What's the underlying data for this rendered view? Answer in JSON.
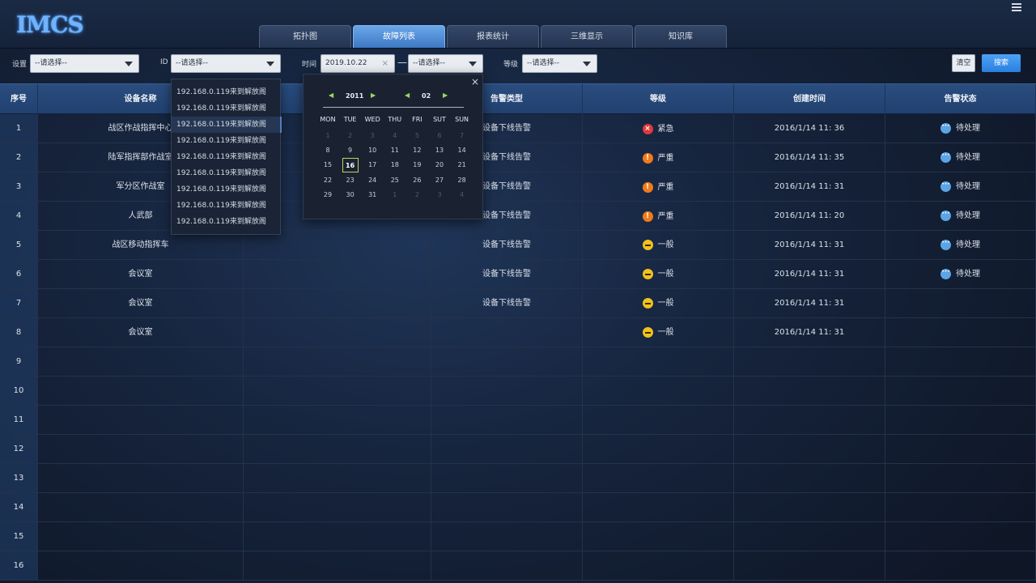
{
  "app": {
    "logo": "IMCS"
  },
  "tabs": [
    "拓扑图",
    "故障列表",
    "报表统计",
    "三维显示",
    "知识库"
  ],
  "active_tab_index": 1,
  "filters": {
    "device_label": "设置",
    "device_value": "--请选择--",
    "id_label": "ID",
    "id_value": "--请选择--",
    "time_label": "时间",
    "time_start": "2019.10.22",
    "time_clear": "×",
    "time_sep": "—",
    "time_end": "--请选择--",
    "level_label": "等级",
    "level_value": "--请选择--",
    "clear_button": "清空",
    "search_button": "搜索"
  },
  "table": {
    "headers": [
      "序号",
      "设备名称",
      "",
      "告警类型",
      "等级",
      "创建时间",
      "告警状态"
    ],
    "rows": [
      {
        "idx": "1",
        "device": "战区作战指挥中心",
        "type": "设备下线告警",
        "level": "紧急",
        "level_kind": "urgent",
        "time": "2016/1/14 11: 36",
        "status": "待处理"
      },
      {
        "idx": "2",
        "device": "陆军指挥部作战室",
        "type": "设备下线告警",
        "level": "严重",
        "level_kind": "serious",
        "time": "2016/1/14 11: 35",
        "status": "待处理"
      },
      {
        "idx": "3",
        "device": "军分区作战室",
        "type": "设备下线告警",
        "level": "严重",
        "level_kind": "serious",
        "time": "2016/1/14 11: 31",
        "status": "待处理"
      },
      {
        "idx": "4",
        "device": "人武部",
        "type": "设备下线告警",
        "level": "严重",
        "level_kind": "serious",
        "time": "2016/1/14 11: 20",
        "status": "待处理"
      },
      {
        "idx": "5",
        "device": "战区移动指挥车",
        "type": "设备下线告警",
        "level": "一般",
        "level_kind": "normal",
        "time": "2016/1/14 11: 31",
        "status": "待处理"
      },
      {
        "idx": "6",
        "device": "会议室",
        "type": "设备下线告警",
        "level": "一般",
        "level_kind": "normal",
        "time": "2016/1/14 11: 31",
        "status": "待处理"
      },
      {
        "idx": "7",
        "device": "会议室",
        "type": "设备下线告警",
        "level": "一般",
        "level_kind": "normal",
        "time": "2016/1/14 11: 31",
        "status": ""
      },
      {
        "idx": "8",
        "device": "会议室",
        "type": "",
        "level": "一般",
        "level_kind": "normal",
        "time": "2016/1/14 11: 31",
        "status": ""
      },
      {
        "idx": "9",
        "device": "",
        "type": "",
        "level": "",
        "level_kind": "",
        "time": "",
        "status": ""
      },
      {
        "idx": "10",
        "device": "",
        "type": "",
        "level": "",
        "level_kind": "",
        "time": "",
        "status": ""
      },
      {
        "idx": "11",
        "device": "",
        "type": "",
        "level": "",
        "level_kind": "",
        "time": "",
        "status": ""
      },
      {
        "idx": "12",
        "device": "",
        "type": "",
        "level": "",
        "level_kind": "",
        "time": "",
        "status": ""
      },
      {
        "idx": "13",
        "device": "",
        "type": "",
        "level": "",
        "level_kind": "",
        "time": "",
        "status": ""
      },
      {
        "idx": "14",
        "device": "",
        "type": "",
        "level": "",
        "level_kind": "",
        "time": "",
        "status": ""
      },
      {
        "idx": "15",
        "device": "",
        "type": "",
        "level": "",
        "level_kind": "",
        "time": "",
        "status": ""
      },
      {
        "idx": "16",
        "device": "",
        "type": "",
        "level": "",
        "level_kind": "",
        "time": "",
        "status": ""
      }
    ]
  },
  "id_dropdown": {
    "items": [
      "192.168.0.119来到解放阁",
      "192.168.0.119来到解放阁",
      "192.168.0.119来到解放阁",
      "192.168.0.119来到解放阁",
      "192.168.0.119来到解放阁",
      "192.168.0.119来到解放阁",
      "192.168.0.119来到解放阁",
      "192.168.0.119来到解放阁",
      "192.168.0.119来到解放阁"
    ],
    "highlighted_index": 2
  },
  "calendar": {
    "close": "×",
    "year": "2011",
    "month": "02",
    "weekdays": [
      "MON",
      "TUE",
      "WED",
      "THU",
      "FRI",
      "SUT",
      "SUN"
    ],
    "weeks": [
      [
        "1",
        "2",
        "3",
        "4",
        "5",
        "6",
        "7"
      ],
      [
        "8",
        "9",
        "10",
        "11",
        "12",
        "13",
        "14"
      ],
      [
        "15",
        "16",
        "17",
        "18",
        "19",
        "20",
        "21"
      ],
      [
        "22",
        "23",
        "24",
        "25",
        "26",
        "27",
        "28"
      ],
      [
        "29",
        "30",
        "31",
        "1",
        "2",
        "3",
        "4"
      ]
    ],
    "muted_first_week": true,
    "muted_trailing_from": 3,
    "selected": "16"
  },
  "colors": {
    "accent": "#3d78c4",
    "urgent": "#e0383c",
    "serious": "#f07a1c",
    "normal": "#f0c21c",
    "pending": "#5ca4e6"
  },
  "icons": {
    "menu": "hamburger-icon",
    "caret": "caret-down-icon",
    "urgent": "x-circle-icon",
    "serious": "exclamation-circle-icon",
    "normal": "minus-circle-icon",
    "pending": "ellipsis-circle-icon",
    "nav_prev": "triangle-left-icon",
    "nav_next": "triangle-right-icon",
    "close": "close-icon"
  }
}
